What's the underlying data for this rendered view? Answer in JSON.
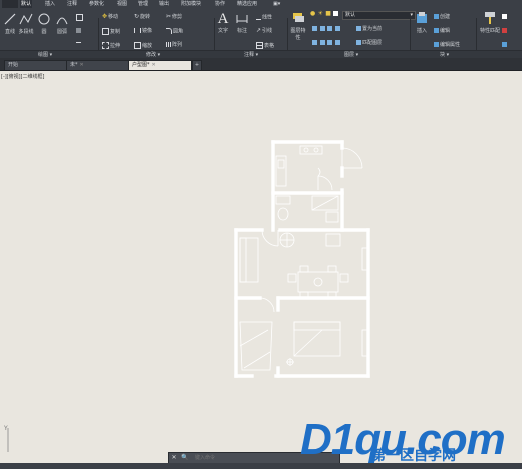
{
  "menu": {
    "items": [
      "默认",
      "插入",
      "注释",
      "参数化",
      "视图",
      "管理",
      "输出",
      "附加模块",
      "协作",
      "精选应用",
      "▣▾"
    ]
  },
  "ribbon": {
    "draw": {
      "big": [
        "直线",
        "多段线",
        "圆",
        "圆弧"
      ]
    },
    "modify": {
      "rows": [
        [
          "移动",
          "旋转",
          "修剪"
        ],
        [
          "复制",
          "镜像",
          "圆角"
        ],
        [
          "拉伸",
          "缩放",
          "阵列"
        ]
      ]
    },
    "annotation": {
      "big": [
        "文字",
        "标注"
      ],
      "rows": [
        "线性",
        "引线",
        "表格"
      ]
    },
    "layers": {
      "big": [
        "图层特性"
      ],
      "current": "默认",
      "rows": [
        "置为当前",
        "匹配图层"
      ]
    },
    "block": {
      "big": [
        "插入"
      ],
      "rows": [
        "创建",
        "编辑",
        "编辑属性"
      ]
    },
    "properties": {
      "big": [
        "特性匹配"
      ]
    },
    "panel_labels": [
      "绘图 ▾",
      "修改 ▾",
      "注释 ▾",
      "图层 ▾",
      "块 ▾"
    ]
  },
  "tabs": [
    {
      "label": "开始",
      "active": false
    },
    {
      "label": "未*",
      "active": false
    },
    {
      "label": "户型图*",
      "active": true
    }
  ],
  "tab_add": "+",
  "viewport_label": "[-][俯视][二维线框]",
  "command": {
    "placeholder": "键入命令",
    "close": "✕",
    "search": "🔍"
  },
  "ucs": {
    "x": "X",
    "y": "Y"
  },
  "watermark": {
    "main": "D1qu.com",
    "sub": "第一区自学网"
  },
  "colors": {
    "ribbon": "#3b3f46",
    "canvas": "#e9e6df",
    "walls": "#ffffff",
    "brand": "#1f6fc6"
  }
}
